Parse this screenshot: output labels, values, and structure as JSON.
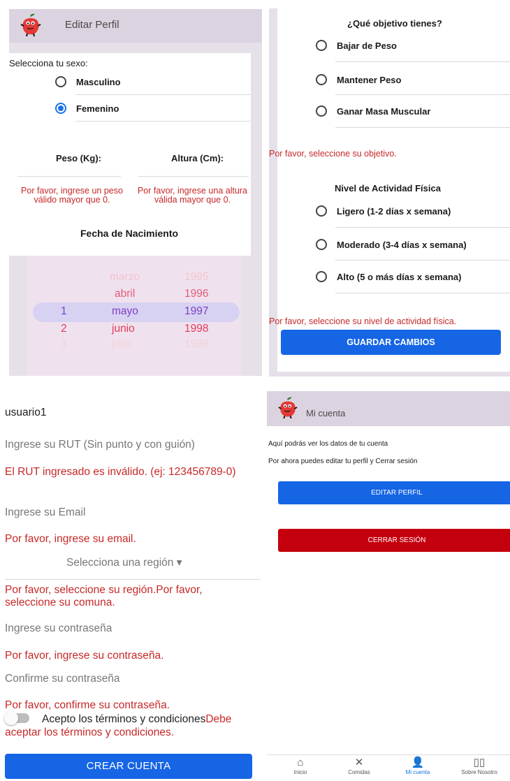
{
  "edit_profile": {
    "title": "Editar Perfil",
    "sex_label": "Selecciona tu sexo:",
    "sex_options": [
      "Masculino",
      "Femenino"
    ],
    "sex_selected": "Femenino",
    "weight_label": "Peso (Kg):",
    "height_label": "Altura (Cm):",
    "weight_error": "Por favor, ingrese un peso válido mayor que 0.",
    "height_error": "Por favor, ingrese una altura válida mayor que 0.",
    "birth_title": "Fecha de Nacimiento",
    "picker": {
      "days": [
        "",
        "",
        "",
        "1",
        "2",
        "3"
      ],
      "months": [
        "",
        "marzo",
        "abril",
        "mayo",
        "junio",
        "julio"
      ],
      "years": [
        "",
        "1995",
        "1996",
        "1997",
        "1998",
        "1999"
      ],
      "selected": {
        "day": "1",
        "month": "mayo",
        "year": "1997"
      }
    }
  },
  "goals": {
    "question": "¿Qué objetivo tienes?",
    "options": [
      "Bajar de Peso",
      "Mantener Peso",
      "Ganar Masa Muscular"
    ],
    "goal_error": "Por favor, seleccione su objetivo.",
    "activity_title": "Nivel de Actividad Física",
    "activity_options": [
      "Ligero (1-2 días x semana)",
      "Moderado (3-4 días x semana)",
      "Alto (5 o más días x semana)"
    ],
    "activity_error": "Por favor, seleccione su nivel de actividad física.",
    "save_button": "GUARDAR CAMBIOS"
  },
  "register": {
    "username": "usuario1",
    "rut_placeholder": "Ingrese su RUT (Sin punto y con guión)",
    "rut_error": "El RUT ingresado es inválido. (ej: 123456789-0)",
    "email_placeholder": "Ingrese su Email",
    "email_error": "Por favor, ingrese su email.",
    "region_select": "Selecciona una región ▾",
    "region_error": "Por favor, seleccione su región.Por favor, seleccione su comuna.",
    "password_placeholder": "Ingrese su contraseña",
    "password_error": "Por favor, ingrese su contraseña.",
    "confirm_placeholder": "Confirme su contraseña",
    "confirm_error": "Por favor, confirme su contraseña.",
    "terms_label": "Acepto los términos y condiciones",
    "terms_error": "Debe aceptar los términos y condiciones.",
    "create_button": "CREAR CUENTA"
  },
  "account": {
    "title": "Mi cuenta",
    "info1": "Aquí podrás ver los datos de tu cuenta",
    "info2": "Por ahora puedes editar tu perfil y Cerrar sesión",
    "edit_button": "EDITAR PERFIL",
    "logout_button": "CERRAR SESIÓN",
    "tabs": [
      {
        "label": "Inicio",
        "icon": "home-icon"
      },
      {
        "label": "Comidas",
        "icon": "utensils-icon"
      },
      {
        "label": "Mi cuenta",
        "icon": "person-icon"
      },
      {
        "label": "Sobre Nosotro",
        "icon": "book-icon"
      }
    ],
    "active_tab": "Mi cuenta"
  },
  "colors": {
    "primary_blue": "#1565e5",
    "danger_red": "#c4000f",
    "error_text": "#c62828",
    "header_bg": "#dcd3e0"
  }
}
